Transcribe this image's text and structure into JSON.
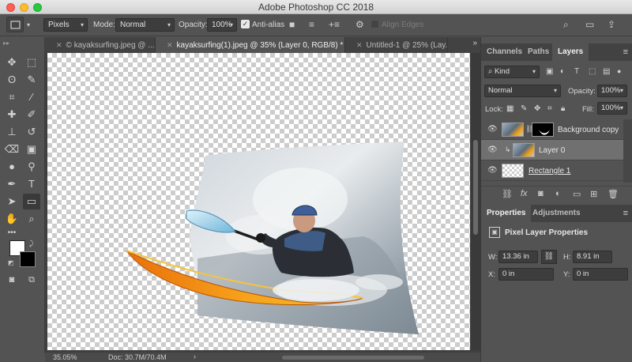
{
  "app": {
    "title": "Adobe Photoshop CC 2018"
  },
  "options": {
    "units": "Pixels",
    "mode_label": "Mode:",
    "mode_value": "Normal",
    "opacity_label": "Opacity:",
    "opacity_value": "100%",
    "antialias_label": "Anti-alias",
    "align_label": "Align Edges"
  },
  "tabs": [
    {
      "label": "© kayaksurfing.jpeg @ ..."
    },
    {
      "label": "kayaksurfing(1).jpeg @ 35% (Layer 0, RGB/8) *"
    },
    {
      "label": "Untitled-1 @ 25% (Lay..."
    }
  ],
  "status": {
    "zoom": "35.05%",
    "doc": "Doc: 30.7M/70.4M"
  },
  "layers_panel": {
    "tabs": [
      "Channels",
      "Paths",
      "Layers"
    ],
    "filter_kind": "Kind",
    "blend_mode": "Normal",
    "opacity_label": "Opacity:",
    "opacity_value": "100%",
    "lock_label": "Lock:",
    "fill_label": "Fill:",
    "fill_value": "100%",
    "layers": [
      {
        "name": "Background copy"
      },
      {
        "name": "Layer 0"
      },
      {
        "name": "Rectangle 1"
      }
    ]
  },
  "properties_panel": {
    "tabs": [
      "Properties",
      "Adjustments"
    ],
    "title": "Pixel Layer Properties",
    "w_label": "W:",
    "w_value": "13.36 in",
    "h_label": "H:",
    "h_value": "8.91 in",
    "x_label": "X:",
    "x_value": "0 in",
    "y_label": "Y:",
    "y_value": "0 in"
  },
  "colors": {
    "foreground": "#ffffff",
    "background": "#000000",
    "kayak": "#f29a12"
  }
}
